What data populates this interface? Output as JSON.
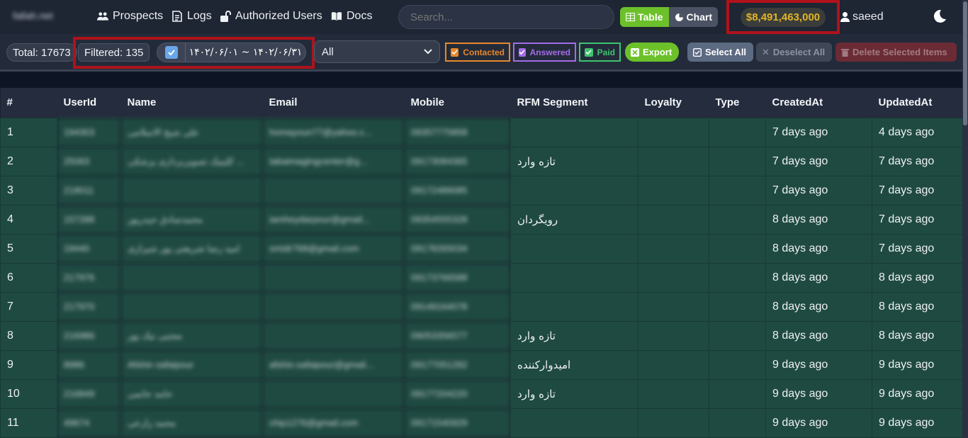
{
  "header": {
    "brand": "fallah.net",
    "nav": [
      {
        "label": "Prospects",
        "icon": "users-icon"
      },
      {
        "label": "Logs",
        "icon": "log-icon"
      },
      {
        "label": "Authorized Users",
        "icon": "lock-icon"
      },
      {
        "label": "Docs",
        "icon": "book-icon"
      }
    ],
    "search_placeholder": "Search...",
    "view_table_label": "Table",
    "view_chart_label": "Chart",
    "balance": "$8,491,463,000",
    "username": "saeed"
  },
  "toolbar": {
    "total": "Total: 17673",
    "filtered": "Filtered: 135",
    "date_range": "۱۴۰۲/۰۶/۰۱ ~ ۱۴۰۲/۰۶/۳۱",
    "select_value": "All",
    "contacted_label": "Contacted",
    "answered_label": "Answered",
    "paid_label": "Paid",
    "export_label": "Export",
    "select_all_label": "Select All",
    "deselect_all_label": "Deselect All",
    "delete_selected_label": "Delete Selected Items"
  },
  "colors": {
    "accent_green": "#6cc12b",
    "balance_gold": "#e2b42a",
    "highlight_red": "#b0121b",
    "contacted_orange": "#e8872a",
    "answered_purple": "#a56be8",
    "paid_green": "#3ec46e",
    "row_bg": "#1f4a42"
  },
  "table": {
    "columns": [
      "#",
      "UserId",
      "Name",
      "Email",
      "Mobile",
      "RFM Segment",
      "Loyalty",
      "Type",
      "CreatedAt",
      "UpdatedAt"
    ],
    "rows": [
      [
        "1",
        "194303",
        "علی شیخ الاسلامی",
        "homayoun77@yahoo.c...",
        "09357775858",
        "",
        "",
        "",
        "7 days ago",
        "4 days ago"
      ],
      [
        "2",
        "25063",
        "کلینیک تصویربرداری پزشکی ... ",
        "tabaimagingcenter@g...",
        "09173084365",
        "تازه وارد",
        "",
        "",
        "7 days ago",
        "7 days ago"
      ],
      [
        "3",
        "218011",
        "",
        "",
        "09172489085",
        "",
        "",
        "",
        "7 days ago",
        "7 days ago"
      ],
      [
        "4",
        "157288",
        "محمدصادق حیدرپور",
        "iamheydarpour@gmail...",
        "09354555328",
        "رویگردان",
        "",
        "",
        "8 days ago",
        "7 days ago"
      ],
      [
        "5",
        "19440",
        "امید رضا شریعتی پور شیرازی",
        "omidr768@gmail.com",
        "09178265034",
        "",
        "",
        "",
        "8 days ago",
        "7 days ago"
      ],
      [
        "6",
        "217976",
        "",
        "",
        "09173766588",
        "",
        "",
        "",
        "8 days ago",
        "8 days ago"
      ],
      [
        "7",
        "217970",
        "",
        "",
        "09149164078",
        "",
        "",
        "",
        "8 days ago",
        "8 days ago"
      ],
      [
        "8",
        "216986",
        "مجتبی نیک پور",
        "",
        "09053356577",
        "تازه وارد",
        "",
        "",
        "8 days ago",
        "8 days ago"
      ],
      [
        "9",
        "8986",
        "Afshin safaipour",
        "afshin.safaipour@gmail...",
        "09177051282",
        "امیدوارکننده",
        "",
        "",
        "9 days ago",
        "9 days ago"
      ],
      [
        "10",
        "216849",
        "حامد حاتمی",
        "",
        "09177204220",
        "تازه وارد",
        "",
        "",
        "9 days ago",
        "9 days ago"
      ],
      [
        "11",
        "49674",
        "محمد زارعی",
        "chip1276@gmail.com",
        "09171540929",
        "",
        "",
        "",
        "9 days ago",
        "9 days ago"
      ]
    ]
  }
}
